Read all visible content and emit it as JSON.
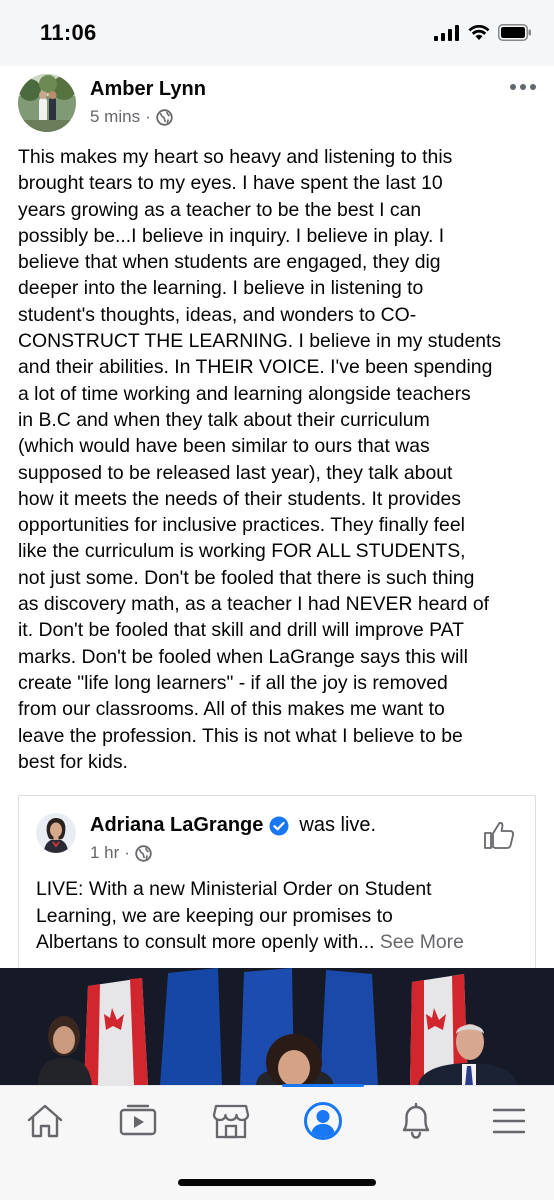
{
  "status_bar": {
    "time": "11:06"
  },
  "post": {
    "author": "Amber Lynn",
    "time": "5 mins",
    "separator": "·",
    "body": "This makes my heart so heavy and listening to this\nbrought tears to my eyes.  I have spent the last 10\nyears growing as a teacher to be the best I can\npossibly be...I believe in inquiry. I believe in play. I\nbelieve that when students are engaged, they dig\ndeeper into the learning. I believe in listening to\nstudent's thoughts, ideas, and wonders to CO-\nCONSTRUCT THE LEARNING. I believe in my students\nand their abilities. In THEIR VOICE. I've been spending\na lot of time working and learning alongside teachers\nin B.C and when they talk about their curriculum\n(which would have been similar to ours that was\nsupposed to be released last year), they talk about\nhow it meets the needs of their students. It provides\nopportunities for inclusive practices. They finally feel\nlike the curriculum is working FOR ALL STUDENTS,\nnot just some. Don't be fooled that there is such thing\nas discovery math, as a teacher I had NEVER heard of\nit. Don't be fooled that skill and drill will improve PAT\nmarks. Don't be fooled when LaGrange says this will\ncreate \"life long learners\" - if all the joy is removed\nfrom our classrooms. All of this makes me want to\nleave the profession. This is not what I believe to be\nbest for kids."
  },
  "shared": {
    "name": "Adriana LaGrange",
    "status": "was live.",
    "time": "1 hr",
    "separator": "·",
    "text": "LIVE: With a new Ministerial Order on Student\nLearning, we are keeping our promises to\nAlbertans to consult more openly with... ",
    "see_more": "See More"
  },
  "nav": {
    "items": [
      "home-icon",
      "watch-icon",
      "marketplace-icon",
      "profile-icon",
      "notifications-icon",
      "menu-icon"
    ],
    "active": "profile-icon"
  },
  "colors": {
    "accent": "#1877f2",
    "meta": "#65676b",
    "verified": "#1877f2"
  }
}
